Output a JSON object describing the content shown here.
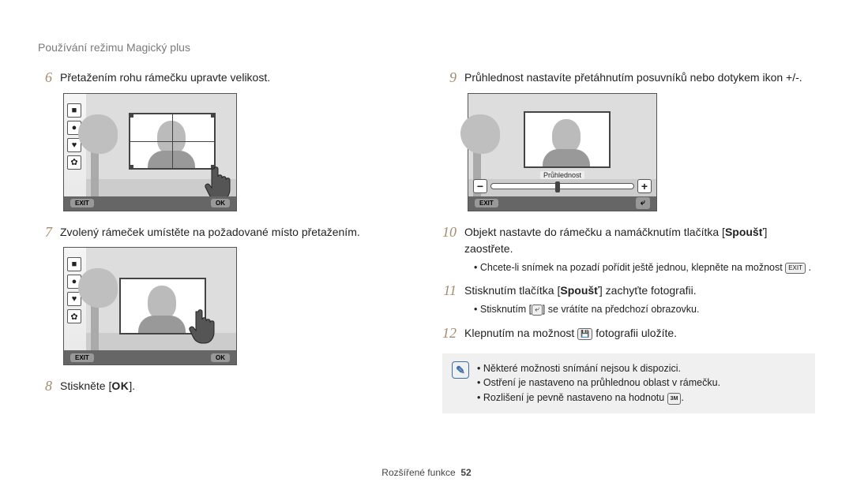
{
  "header": {
    "title": "Používání režimu Magický plus"
  },
  "left": {
    "step6": {
      "num": "6",
      "text": "Přetažením rohu rámečku upravte velikost."
    },
    "step7": {
      "num": "7",
      "text": "Zvolený rámeček umístěte na požadované místo přetažením."
    },
    "step8": {
      "num": "8",
      "text_before": "Stiskněte [",
      "ok": "OK",
      "text_after": "]."
    }
  },
  "right": {
    "step9": {
      "num": "9",
      "text": "Průhlednost nastavíte přetáhnutím posuvníků nebo dotykem ikon +/-."
    },
    "step10": {
      "num": "10",
      "text_a": "Objekt nastavte do rámečku a namáčknutím tlačítka [",
      "bold": "Spoušť",
      "text_b": "] zaostřete.",
      "sub": "Chcete-li snímek na pozadí pořídit ještě jednou, klepněte na možnost "
    },
    "step11": {
      "num": "11",
      "text_a": "Stisknutím tlačítka [",
      "bold": "Spoušť",
      "text_b": "] zachyťte fotografii.",
      "sub_a": "Stisknutím [",
      "sub_b": "] se vrátíte na předchozí obrazovku."
    },
    "step12": {
      "num": "12",
      "text_a": "Klepnutím na možnost ",
      "text_b": " fotografii uložíte."
    },
    "notes": {
      "n1": "Některé možnosti snímání nejsou k dispozici.",
      "n2": "Ostření je nastaveno na průhlednou oblast v rámečku.",
      "n3_a": "Rozlišení je pevně nastaveno na hodnotu ",
      "n3_b": "."
    }
  },
  "screens": {
    "sidebar": {
      "i1": "■",
      "i2": "●",
      "i3": "♥",
      "i4": "✿"
    },
    "exit_label": "EXIT",
    "ok_label": "OK",
    "transparency_label": "Průhlednost",
    "count": "1"
  },
  "footer": {
    "section": "Rozšířené funkce",
    "page": "52"
  }
}
